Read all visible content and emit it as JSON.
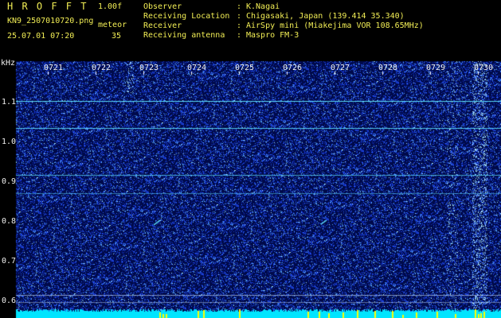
{
  "header": {
    "brand": "H R O F F T",
    "version": "1.00f",
    "filename": "KN9_2507010720.png",
    "datetime": "25.07.01 07:20",
    "meteor_label": "meteor",
    "meteor_count": "35"
  },
  "station": {
    "rows": [
      {
        "label": "Observer",
        "sep": ":",
        "value": "K.Nagai"
      },
      {
        "label": "Receiving Location",
        "sep": ":",
        "value": "Chigasaki, Japan (139.414 35.340)"
      },
      {
        "label": "Receiver",
        "sep": ":",
        "value": "AirSpy mini (Miakejima VOR 108.65MHz)"
      },
      {
        "label": "Receiving antenna",
        "sep": ":",
        "value": "Maspro FM-3"
      }
    ]
  },
  "spectrogram": {
    "unit_label": "kHz",
    "time_ticks": [
      "0721",
      "0722",
      "0723",
      "0724",
      "0725",
      "0726",
      "0727",
      "0728",
      "0729",
      "0730"
    ],
    "freq_ticks": [
      "1.1",
      "1.0",
      "0.9",
      "0.8",
      "0.7",
      "0.6"
    ],
    "colors": {
      "background": "#000a4a",
      "noise": "#2a58ff",
      "line": "#5fe6ff",
      "bottom_bar": "#00e5ff",
      "spike": "#ffff00"
    }
  }
}
